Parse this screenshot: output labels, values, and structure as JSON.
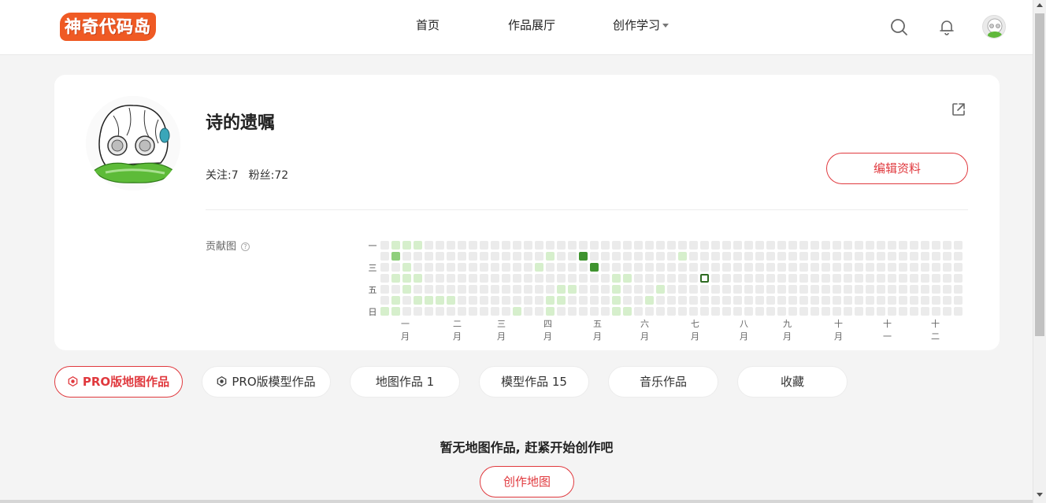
{
  "header": {
    "logo_text": "神奇代码岛",
    "nav": {
      "home": "首页",
      "gallery": "作品展厅",
      "learn": "创作学习"
    },
    "icons": {
      "search": "search-icon",
      "notifications": "bell-icon",
      "avatar": "avatar"
    }
  },
  "profile": {
    "username": "诗的遗嘱",
    "follow": "关注:7",
    "fans": "粉丝:72",
    "edit_label": "编辑资料",
    "share_icon": "external-link-icon"
  },
  "contrib": {
    "label": "贡献图",
    "help": "?",
    "days": [
      "一",
      "三",
      "五",
      "日"
    ],
    "months": [
      "一月",
      "二月",
      "三月",
      "四月",
      "五月",
      "六月",
      "七月",
      "八月",
      "九月",
      "十月",
      "十一",
      "十二"
    ],
    "colors": {
      "empty": "#ebebeb",
      "l1": "#d6efcc",
      "l2": "#8fcf7c",
      "l3": "#3f932f"
    },
    "active_cells": [
      {
        "week": 1,
        "day": 0,
        "level": 1
      },
      {
        "week": 2,
        "day": 0,
        "level": 1
      },
      {
        "week": 3,
        "day": 0,
        "level": 1
      },
      {
        "week": 1,
        "day": 1,
        "level": 2
      },
      {
        "week": 2,
        "day": 2,
        "level": 1
      },
      {
        "week": 1,
        "day": 3,
        "level": 1
      },
      {
        "week": 2,
        "day": 3,
        "level": 1
      },
      {
        "week": 3,
        "day": 3,
        "level": 1
      },
      {
        "week": 2,
        "day": 4,
        "level": 1
      },
      {
        "week": 1,
        "day": 5,
        "level": 1
      },
      {
        "week": 3,
        "day": 5,
        "level": 1
      },
      {
        "week": 4,
        "day": 5,
        "level": 1
      },
      {
        "week": 5,
        "day": 5,
        "level": 1
      },
      {
        "week": 6,
        "day": 5,
        "level": 1
      },
      {
        "week": 0,
        "day": 6,
        "level": 1
      },
      {
        "week": 1,
        "day": 6,
        "level": 1
      },
      {
        "week": 12,
        "day": 6,
        "level": 1
      },
      {
        "week": 15,
        "day": 1,
        "level": 1
      },
      {
        "week": 14,
        "day": 2,
        "level": 1
      },
      {
        "week": 16,
        "day": 4,
        "level": 1
      },
      {
        "week": 17,
        "day": 4,
        "level": 1
      },
      {
        "week": 15,
        "day": 5,
        "level": 1
      },
      {
        "week": 16,
        "day": 5,
        "level": 1
      },
      {
        "week": 15,
        "day": 6,
        "level": 1
      },
      {
        "week": 18,
        "day": 1,
        "level": 3
      },
      {
        "week": 19,
        "day": 2,
        "level": 3
      },
      {
        "week": 21,
        "day": 3,
        "level": 1
      },
      {
        "week": 22,
        "day": 3,
        "level": 1
      },
      {
        "week": 21,
        "day": 4,
        "level": 1
      },
      {
        "week": 21,
        "day": 5,
        "level": 1
      },
      {
        "week": 21,
        "day": 6,
        "level": 1
      },
      {
        "week": 22,
        "day": 6,
        "level": 1
      },
      {
        "week": 24,
        "day": 5,
        "level": 1
      },
      {
        "week": 25,
        "day": 4,
        "level": 1
      },
      {
        "week": 27,
        "day": 1,
        "level": 1
      }
    ],
    "today": {
      "week": 29,
      "day": 3
    }
  },
  "tabs": [
    {
      "label": "PRO版地图作品",
      "icon": "pro-icon"
    },
    {
      "label": "PRO版模型作品",
      "icon": "pro-icon"
    },
    {
      "label": "地图作品 1"
    },
    {
      "label": "模型作品 15"
    },
    {
      "label": "音乐作品"
    },
    {
      "label": "收藏"
    }
  ],
  "empty": {
    "message": "暂无地图作品, 赶紧开始创作吧",
    "create_label": "创作地图"
  }
}
